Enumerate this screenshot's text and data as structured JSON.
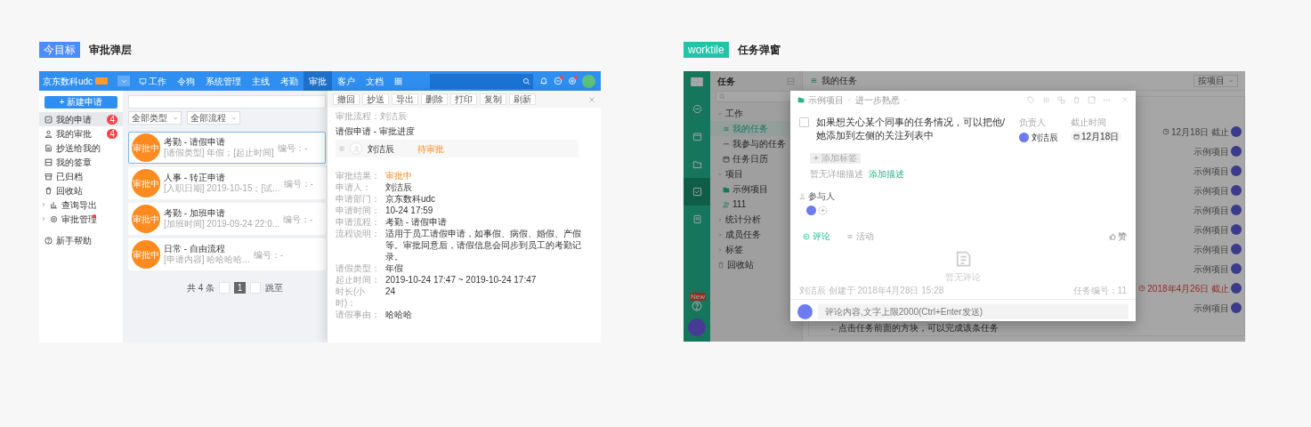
{
  "left": {
    "tag": "今目标",
    "caption": "审批弹层",
    "app": {
      "brand": "京东数科udc",
      "nav": [
        {
          "label": "工作",
          "selected": false
        },
        {
          "label": "令狗",
          "selected": false
        },
        {
          "label": "系统管理",
          "selected": false
        },
        {
          "label": "主线",
          "selected": false
        },
        {
          "label": "考勤",
          "selected": false
        },
        {
          "label": "审批",
          "selected": true
        },
        {
          "label": "客户",
          "selected": false
        },
        {
          "label": "文档",
          "selected": false
        }
      ],
      "top_icons": [
        {
          "notice": false
        },
        {
          "notice": true
        },
        {
          "notice": true
        }
      ],
      "new_button": "+ 新建申请",
      "menu": [
        {
          "label": "我的申请",
          "selected": true,
          "count": "4",
          "notice": false
        },
        {
          "label": "我的审批",
          "selected": false,
          "count": "4",
          "notice": false
        },
        {
          "label": "抄送给我的",
          "selected": false,
          "notice": false
        },
        {
          "label": "我的签章",
          "selected": false,
          "notice": false
        },
        {
          "label": "已归档",
          "selected": false,
          "notice": false
        },
        {
          "label": "回收站",
          "selected": false,
          "notice": false
        },
        {
          "label": "查询导出",
          "kind": "group",
          "expanded": false,
          "selected": false,
          "notice": false
        },
        {
          "label": "审批管理",
          "kind": "group",
          "expanded": false,
          "selected": false,
          "notice": true
        },
        {
          "label": "新手帮助",
          "kind": "help",
          "selected": false,
          "notice": false
        }
      ],
      "filters": [
        "全部类型",
        "全部流程"
      ],
      "cards": [
        {
          "status": "审批中",
          "title": "考勤 - 请假申请",
          "summary": "[请假类型] 年假；[起止时间]",
          "number": "编号：-",
          "selected": true
        },
        {
          "status": "审批中",
          "title": "人事 - 转正申请",
          "summary": "[入职日期] 2019-10-15；[试...",
          "number": "编号：-",
          "selected": false
        },
        {
          "status": "审批中",
          "title": "考勤 - 加班申请",
          "summary": "[加班时间] 2019-09-24 22:0...",
          "number": "编号：-",
          "selected": false
        },
        {
          "status": "审批中",
          "title": "日常 - 自由流程",
          "summary": "[申请内容] 哈哈哈哈...",
          "number": "编号：-",
          "selected": false
        }
      ],
      "pager": {
        "total": "共 4 条",
        "pages": [
          {
            "label": "1",
            "selected": true
          }
        ],
        "jump": "跳至"
      },
      "detail": {
        "actions": [
          "撤回",
          "抄送",
          "导出",
          "删除",
          "打印",
          "复制",
          "刷新"
        ],
        "breadcrumb": "审批流程：刘洁辰",
        "heading": "请假申请 - 审批进度",
        "approver": {
          "name": "刘洁辰",
          "status": "待审批"
        },
        "fields": [
          {
            "label": "审批结果：",
            "value": "审批中",
            "kind": "status"
          },
          {
            "label": "申请人：",
            "value": "刘洁辰",
            "kind": "text"
          },
          {
            "label": "申请部门：",
            "value": "京东数科udc",
            "kind": "text"
          },
          {
            "label": "申请时间：",
            "value": "10-24 17:59",
            "kind": "text"
          },
          {
            "label": "申请流程：",
            "value": "考勤 - 请假申请",
            "kind": "text"
          },
          {
            "label": "流程说明：",
            "value": "适用于员工请假申请，如事假、病假、婚假、产假等。审批同意后，请假信息会同步到员工的考勤记录。",
            "kind": "text"
          },
          {
            "label": "请假类型：",
            "value": "年假",
            "kind": "text"
          },
          {
            "label": "起止时间：",
            "value": "2019-10-24 17:47 ~ 2019-10-24 17:47",
            "kind": "text"
          },
          {
            "label": "时长(小时)：",
            "value": "24",
            "kind": "text"
          },
          {
            "label": "请假事由：",
            "value": "哈哈哈",
            "kind": "text"
          }
        ]
      }
    }
  },
  "right": {
    "tag": "worktile",
    "caption": "任务弹窗",
    "app": {
      "rail": [
        {
          "selected": false
        },
        {
          "selected": false
        },
        {
          "selected": false
        },
        {
          "selected": true
        },
        {
          "selected": false
        }
      ],
      "new_badge": "New",
      "sidebar": {
        "title": "任务",
        "tree": [
          {
            "label": "工作",
            "expanded": true,
            "children": [
              {
                "label": "我的任务",
                "selected": true
              },
              {
                "label": "我参与的任务",
                "selected": false
              },
              {
                "label": "任务日历",
                "selected": false
              }
            ]
          },
          {
            "label": "项目",
            "expanded": true,
            "children": [
              {
                "label": "示例项目",
                "selected": false
              },
              {
                "label": "111",
                "selected": false
              }
            ]
          },
          {
            "label": "统计分析",
            "expanded": false
          },
          {
            "label": "成员任务",
            "expanded": false
          },
          {
            "label": "标签",
            "expanded": false
          },
          {
            "label": "回收站",
            "kind": "leaf"
          }
        ]
      },
      "header": {
        "title": "我的任务",
        "group_by": "按项目"
      },
      "rows": [
        {
          "text": "12月18日 截止",
          "kind": "due"
        },
        {
          "text": "示例项目",
          "kind": "project"
        },
        {
          "text": "示例项目",
          "kind": "project"
        },
        {
          "text": "示例项目",
          "kind": "project"
        },
        {
          "text": "示例项目",
          "kind": "project"
        },
        {
          "text": "示例项目",
          "kind": "project"
        },
        {
          "text": "示例项目",
          "kind": "project"
        },
        {
          "text": "示例项目",
          "kind": "project"
        },
        {
          "text": "2018年4月26日 截止",
          "kind": "overdue"
        },
        {
          "text": "示例项目",
          "kind": "project"
        }
      ],
      "hint": "←点击任务前面的方块，可以完成该条任务",
      "modal": {
        "project": "示例项目",
        "stage": "进一步熟悉",
        "title": "如果想关心某个同事的任务情况，可以把他/她添加到左侧的关注列表中",
        "done": false,
        "assignee_label": "负责人",
        "assignee": "刘洁辰",
        "due_label": "截止时间",
        "due": "12月18日",
        "add_tag": "+ 添加标签",
        "no_desc": "暂无详细描述",
        "add_desc": "添加描述",
        "participants_label": "参与人",
        "tabs": [
          {
            "label": "评论",
            "selected": true
          },
          {
            "label": "活动",
            "selected": false
          }
        ],
        "like": "赞",
        "empty": "暂无评论",
        "created": "刘洁辰 创建于 2018年4月28日 15:28",
        "task_no": "任务编号：11",
        "comment_placeholder": "评论内容,文字上限2000(Ctrl+Enter发送)"
      }
    }
  }
}
